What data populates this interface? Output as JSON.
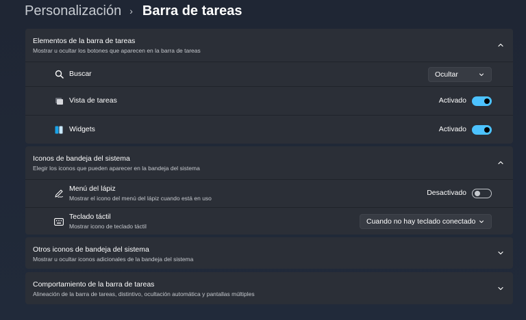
{
  "breadcrumb": {
    "parent": "Personalización",
    "separator": "›",
    "current": "Barra de tareas"
  },
  "sections": {
    "taskbar_items": {
      "title": "Elementos de la barra de tareas",
      "subtitle": "Mostrar u ocultar los botones que aparecen en la barra de tareas",
      "expanded": true,
      "rows": {
        "search": {
          "label": "Buscar",
          "icon": "search-icon",
          "value": "Ocultar"
        },
        "task_view": {
          "label": "Vista de tareas",
          "icon": "task-view-icon",
          "state": "Activado",
          "on": true
        },
        "widgets": {
          "label": "Widgets",
          "icon": "widgets-icon",
          "state": "Activado",
          "on": true
        }
      }
    },
    "tray_icons": {
      "title": "Iconos de bandeja del sistema",
      "subtitle": "Elegir los iconos que pueden aparecer en la bandeja del sistema",
      "expanded": true,
      "rows": {
        "pen_menu": {
          "label": "Menú del lápiz",
          "sub": "Mostrar el icono del menú del lápiz cuando está en uso",
          "icon": "pen-icon",
          "state": "Desactivado",
          "on": false
        },
        "touch_keyboard": {
          "label": "Teclado táctil",
          "sub": "Mostrar icono de teclado táctil",
          "icon": "keyboard-icon",
          "value": "Cuando no hay teclado conectado"
        }
      }
    },
    "other_tray_icons": {
      "title": "Otros iconos de bandeja del sistema",
      "subtitle": "Mostrar u ocultar iconos adicionales de la bandeja del sistema",
      "expanded": false
    },
    "taskbar_behavior": {
      "title": "Comportamiento de la barra de tareas",
      "subtitle": "Alineación de la barra de tareas, distintivo, ocultación automática y pantallas múltiples",
      "expanded": false
    }
  },
  "colors": {
    "accent": "#4cc2ff",
    "card": "#2b2f37",
    "background": "#202838"
  }
}
